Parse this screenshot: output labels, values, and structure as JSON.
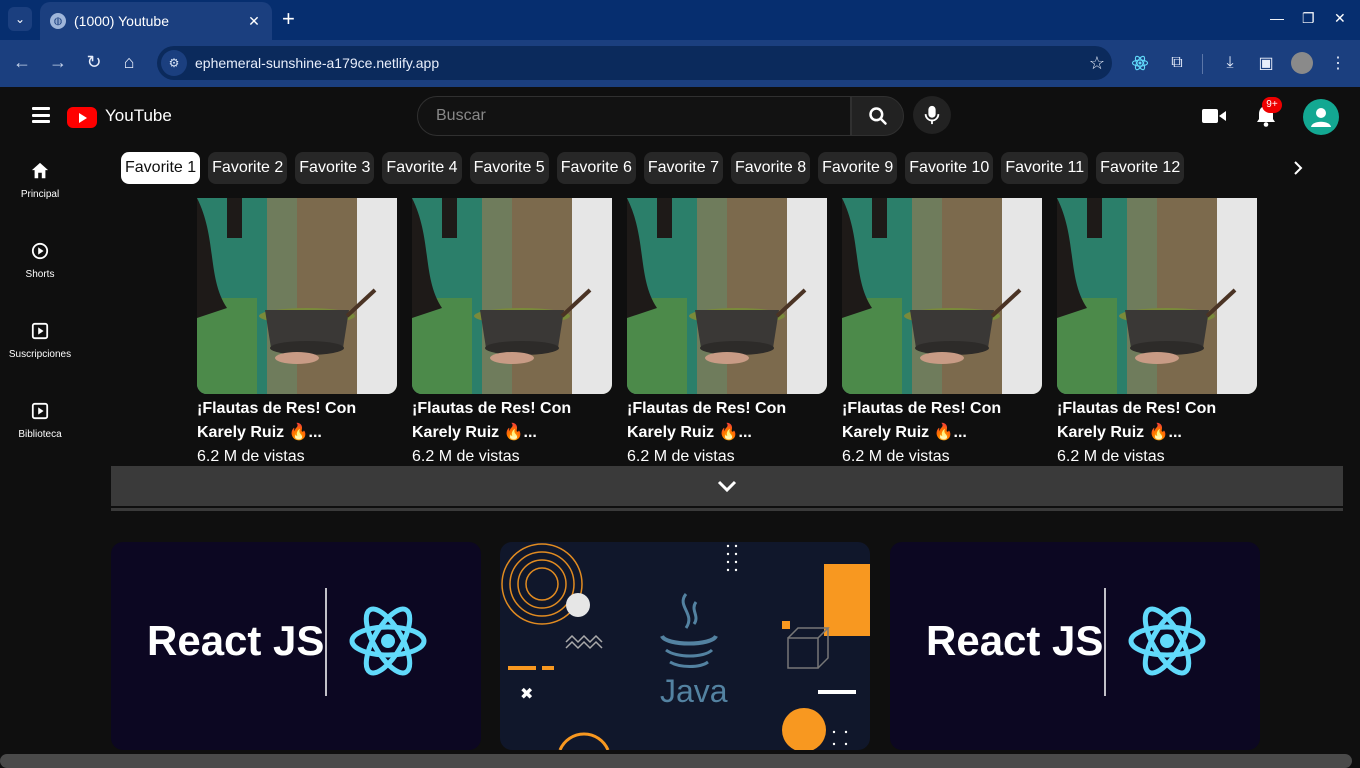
{
  "browser": {
    "tab_title": "(1000) Youtube",
    "url": "ephemeral-sunshine-a179ce.netlify.app",
    "tab_close": "✕",
    "new_tab": "+"
  },
  "header": {
    "brand": "YouTube",
    "search_placeholder": "Buscar",
    "notification_badge": "9+"
  },
  "sidebar": {
    "items": [
      {
        "label": "Principal",
        "icon": "home-icon"
      },
      {
        "label": "Shorts",
        "icon": "play-circle-icon"
      },
      {
        "label": "Suscripciones",
        "icon": "play-square-icon"
      },
      {
        "label": "Biblioteca",
        "icon": "play-square-icon"
      }
    ]
  },
  "chips": [
    "Favorite 1",
    "Favorite 2",
    "Favorite 3",
    "Favorite 4",
    "Favorite 5",
    "Favorite 6",
    "Favorite 7",
    "Favorite 8",
    "Favorite 9",
    "Favorite 10",
    "Favorite 11",
    "Favorite 12"
  ],
  "videos": [
    {
      "title_line1": "¡Flautas de Res! Con",
      "title_line2": "Karely Ruiz 🔥...",
      "views": "6.2 M de vistas"
    },
    {
      "title_line1": "¡Flautas de Res! Con",
      "title_line2": "Karely Ruiz 🔥...",
      "views": "6.2 M de vistas"
    },
    {
      "title_line1": "¡Flautas de Res! Con",
      "title_line2": "Karely Ruiz 🔥...",
      "views": "6.2 M de vistas"
    },
    {
      "title_line1": "¡Flautas de Res! Con",
      "title_line2": "Karely Ruiz 🔥...",
      "views": "6.2 M de vistas"
    },
    {
      "title_line1": "¡Flautas de Res! Con",
      "title_line2": "Karely Ruiz 🔥...",
      "views": "6.2 M de vistas"
    }
  ],
  "big_thumbs": [
    {
      "text": "React JS"
    },
    {
      "text": "Java"
    },
    {
      "text": "React JS"
    }
  ],
  "colors": {
    "chrome_tabbar": "#062e6f",
    "chrome_toolbar": "#1b3f7f",
    "background": "#0f0f0f",
    "youtube_red": "#ff0000",
    "avatar": "#13a892",
    "react_blue": "#61dafb",
    "java_orange": "#f89820"
  }
}
